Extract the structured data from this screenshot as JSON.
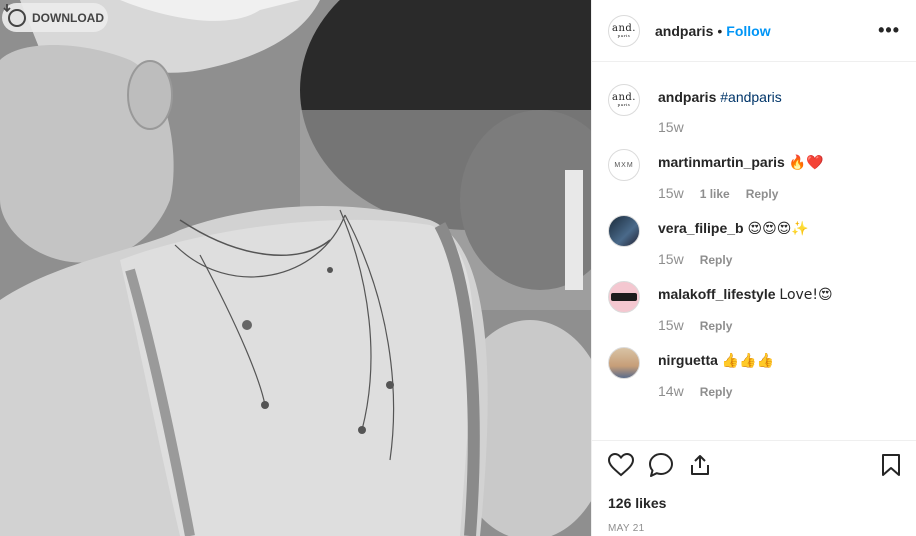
{
  "download": {
    "label": "DOWNLOAD"
  },
  "post": {
    "author": "andparis",
    "follow_label": "Follow",
    "separator": "•",
    "more": "•••",
    "avatar_logo": "and.",
    "avatar_logo_sub": "paris"
  },
  "comments": [
    {
      "user": "andparis",
      "text": "#andparis",
      "time": "15w",
      "likes": "",
      "reply": "",
      "avatar": "andparis-logo"
    },
    {
      "user": "martinmartin_paris",
      "text": "🔥❤️",
      "time": "15w",
      "likes": "1 like",
      "reply": "Reply",
      "avatar": "mxm-logo"
    },
    {
      "user": "vera_filipe_b",
      "text": "😍😍😍✨",
      "time": "15w",
      "likes": "",
      "reply": "Reply",
      "avatar": "dark-photo"
    },
    {
      "user": "malakoff_lifestyle",
      "text": "Love!😍",
      "time": "15w",
      "likes": "",
      "reply": "Reply",
      "avatar": "pink-logo"
    },
    {
      "user": "nirguetta",
      "text": "👍👍👍",
      "time": "14w",
      "likes": "",
      "reply": "Reply",
      "avatar": "face-photo"
    }
  ],
  "avatars": {
    "mxm_text": "MXM"
  },
  "stats": {
    "likes": "126 likes",
    "date": "MAY 21"
  },
  "colors": {
    "accent": "#0095f6",
    "muted": "#8e8e8e",
    "hashtag": "#003569"
  }
}
